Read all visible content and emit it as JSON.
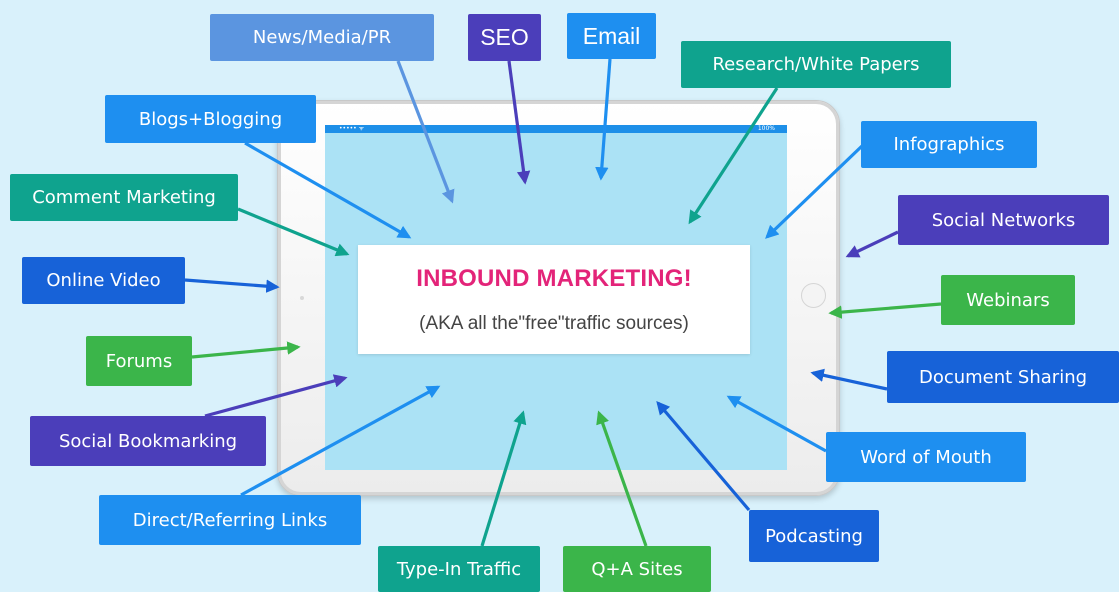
{
  "center": {
    "title": "INBOUND MARKETING!",
    "subtitle": "(AKA all the\"free\"traffic sources)"
  },
  "tablet": {
    "status_left": "••••• ᯤ",
    "status_right": "100%"
  },
  "colors": {
    "background": "#d9f1fb",
    "screen": "#abe2f5",
    "title": "#e32479",
    "light_blue": "#5b95e0",
    "blue": "#1e8ff0",
    "dark_blue": "#1762d8",
    "purple": "#4b3eba",
    "teal": "#0fa38e",
    "green": "#3bb54a"
  },
  "sources": [
    {
      "id": "news-media-pr",
      "label": "News/Media/PR",
      "color": "#5b95e0"
    },
    {
      "id": "seo",
      "label": "SEO",
      "color": "#4b3eba"
    },
    {
      "id": "email",
      "label": "Email",
      "color": "#1e8ff0"
    },
    {
      "id": "research-white-papers",
      "label": "Research/White Papers",
      "color": "#0fa38e"
    },
    {
      "id": "blogs-blogging",
      "label": "Blogs+Blogging",
      "color": "#1e8ff0"
    },
    {
      "id": "infographics",
      "label": "Infographics",
      "color": "#1e8ff0"
    },
    {
      "id": "comment-marketing",
      "label": "Comment Marketing",
      "color": "#0fa38e"
    },
    {
      "id": "social-networks",
      "label": "Social Networks",
      "color": "#4b3eba"
    },
    {
      "id": "online-video",
      "label": "Online Video",
      "color": "#1762d8"
    },
    {
      "id": "webinars",
      "label": "Webinars",
      "color": "#3bb54a"
    },
    {
      "id": "forums",
      "label": "Forums",
      "color": "#3bb54a"
    },
    {
      "id": "document-sharing",
      "label": "Document Sharing",
      "color": "#1762d8"
    },
    {
      "id": "social-bookmarking",
      "label": "Social Bookmarking",
      "color": "#4b3eba"
    },
    {
      "id": "word-of-mouth",
      "label": "Word of Mouth",
      "color": "#1e8ff0"
    },
    {
      "id": "direct-referring-links",
      "label": "Direct/Referring Links",
      "color": "#1e8ff0"
    },
    {
      "id": "podcasting",
      "label": "Podcasting",
      "color": "#1762d8"
    },
    {
      "id": "type-in-traffic",
      "label": "Type-In Traffic",
      "color": "#0fa38e"
    },
    {
      "id": "q-a-sites",
      "label": "Q+A Sites",
      "color": "#3bb54a"
    }
  ]
}
